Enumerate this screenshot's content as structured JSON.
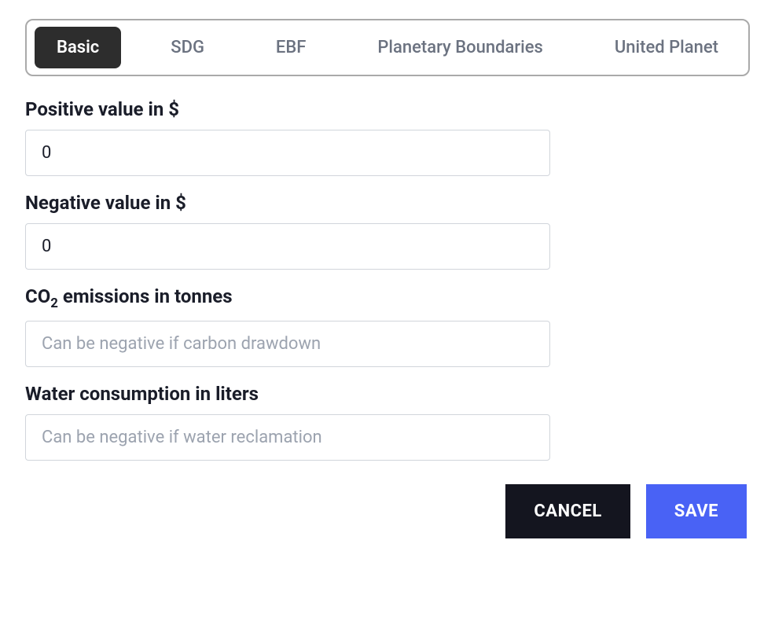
{
  "tabs": {
    "items": [
      {
        "label": "Basic",
        "active": true
      },
      {
        "label": "SDG",
        "active": false
      },
      {
        "label": "EBF",
        "active": false
      },
      {
        "label": "Planetary Boundaries",
        "active": false
      },
      {
        "label": "United Planet",
        "active": false
      }
    ]
  },
  "form": {
    "positive_value": {
      "label": "Positive value in $",
      "value": "0",
      "placeholder": ""
    },
    "negative_value": {
      "label": "Negative value in $",
      "value": "0",
      "placeholder": ""
    },
    "co2_emissions": {
      "label_prefix": "CO",
      "label_sub": "2",
      "label_suffix": " emissions in tonnes",
      "value": "",
      "placeholder": "Can be negative if carbon drawdown"
    },
    "water_consumption": {
      "label": "Water consumption in liters",
      "value": "",
      "placeholder": "Can be negative if water reclamation"
    }
  },
  "buttons": {
    "cancel": "CANCEL",
    "save": "SAVE"
  }
}
